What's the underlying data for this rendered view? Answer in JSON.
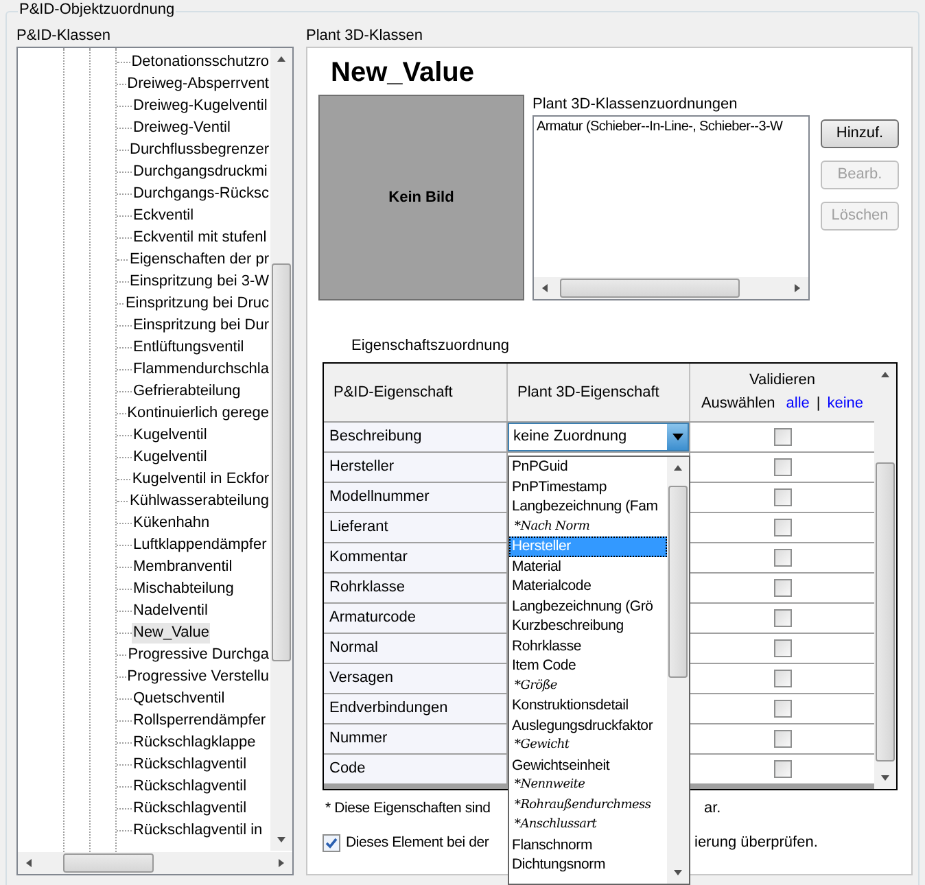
{
  "group_title": "P&ID-Objektzuordnung",
  "left": {
    "label": "P&ID-Klassen",
    "tree_items": [
      {
        "label": "Detonationsschutzro",
        "selected": false
      },
      {
        "label": "Dreiweg-Absperrvent",
        "selected": false
      },
      {
        "label": "Dreiweg-Kugelventil",
        "selected": false
      },
      {
        "label": "Dreiweg-Ventil",
        "selected": false
      },
      {
        "label": "Durchflussbegrenzer",
        "selected": false
      },
      {
        "label": "Durchgangsdruckmi",
        "selected": false
      },
      {
        "label": "Durchgangs-Rücksc",
        "selected": false
      },
      {
        "label": "Eckventil",
        "selected": false
      },
      {
        "label": "Eckventil mit stufenl",
        "selected": false
      },
      {
        "label": "Eigenschaften der pr",
        "selected": false
      },
      {
        "label": "Einspritzung bei 3-W",
        "selected": false
      },
      {
        "label": "Einspritzung bei Druc",
        "selected": false
      },
      {
        "label": "Einspritzung bei Dur",
        "selected": false
      },
      {
        "label": "Entlüftungsventil",
        "selected": false
      },
      {
        "label": "Flammendurchschla",
        "selected": false
      },
      {
        "label": "Gefrierabteilung",
        "selected": false
      },
      {
        "label": "Kontinuierlich gerege",
        "selected": false
      },
      {
        "label": "Kugelventil",
        "selected": false
      },
      {
        "label": "Kugelventil",
        "selected": false
      },
      {
        "label": "Kugelventil in Eckfor",
        "selected": false
      },
      {
        "label": "Kühlwasserabteilung",
        "selected": false
      },
      {
        "label": "Kükenhahn",
        "selected": false
      },
      {
        "label": "Luftklappendämpfer",
        "selected": false
      },
      {
        "label": "Membranventil",
        "selected": false
      },
      {
        "label": "Mischabteilung",
        "selected": false
      },
      {
        "label": "Nadelventil",
        "selected": false
      },
      {
        "label": "New_Value",
        "selected": true
      },
      {
        "label": "Progressive Durchga",
        "selected": false
      },
      {
        "label": "Progressive Verstellu",
        "selected": false
      },
      {
        "label": "Quetschventil",
        "selected": false
      },
      {
        "label": "Rollsperrendämpfer",
        "selected": false
      },
      {
        "label": "Rückschlagklappe",
        "selected": false
      },
      {
        "label": "Rückschlagventil",
        "selected": false
      },
      {
        "label": "Rückschlagventil",
        "selected": false
      },
      {
        "label": "Rückschlagventil",
        "selected": false
      },
      {
        "label": "Rückschlagventil in",
        "selected": false
      }
    ]
  },
  "right": {
    "label": "Plant 3D-Klassen",
    "class_name": "New_Value",
    "image_placeholder": "Kein Bild",
    "assignments_label": "Plant 3D-Klassenzuordnungen",
    "assignments": [
      "Armatur (Schieber--In-Line-, Schieber--3-W"
    ],
    "buttons": [
      {
        "label": "Hinzuf.",
        "disabled": false
      },
      {
        "label": "Bearb.",
        "disabled": true
      },
      {
        "label": "Löschen",
        "disabled": true
      }
    ]
  },
  "properties": {
    "label": "Eigenschaftszuordnung",
    "columns": [
      "P&ID-Eigenschaft",
      "Plant 3D-Eigenschaft"
    ],
    "validate_header": "Validieren",
    "select_label": "Auswählen",
    "select_all": "alle",
    "separator": "|",
    "select_none": "keine",
    "rows": [
      {
        "name": "Beschreibung",
        "mapping": "keine Zuordnung",
        "validate": false
      },
      {
        "name": "Hersteller",
        "validate": false
      },
      {
        "name": "Modellnummer",
        "validate": false
      },
      {
        "name": "Lieferant",
        "validate": false
      },
      {
        "name": "Kommentar",
        "validate": false
      },
      {
        "name": "Rohrklasse",
        "validate": false
      },
      {
        "name": "Armaturcode",
        "validate": false
      },
      {
        "name": "Normal",
        "validate": false
      },
      {
        "name": "Versagen",
        "validate": false
      },
      {
        "name": "Endverbindungen",
        "validate": false
      },
      {
        "name": "Nummer",
        "validate": false
      },
      {
        "name": "Code",
        "validate": false
      }
    ],
    "footnote": [
      "* Diese Eigenschaften sind",
      "ar."
    ],
    "check_element": {
      "checked": true,
      "text": [
        "Dieses Element bei der",
        "ierung überprüfen."
      ]
    }
  },
  "dropdown": {
    "options": [
      {
        "label": "PnPGuid",
        "italic": false,
        "selected": false
      },
      {
        "label": "PnPTimestamp",
        "italic": false,
        "selected": false
      },
      {
        "label": "Langbezeichnung (Fam",
        "italic": false,
        "selected": false
      },
      {
        "label": "*Nach Norm",
        "italic": true,
        "selected": false
      },
      {
        "label": "Hersteller",
        "italic": false,
        "selected": true
      },
      {
        "label": "Material",
        "italic": false,
        "selected": false
      },
      {
        "label": "Materialcode",
        "italic": false,
        "selected": false
      },
      {
        "label": "Langbezeichnung (Grö",
        "italic": false,
        "selected": false
      },
      {
        "label": "Kurzbeschreibung",
        "italic": false,
        "selected": false
      },
      {
        "label": "Rohrklasse",
        "italic": false,
        "selected": false
      },
      {
        "label": "Item Code",
        "italic": false,
        "selected": false
      },
      {
        "label": "*Größe",
        "italic": true,
        "selected": false
      },
      {
        "label": "Konstruktionsdetail",
        "italic": false,
        "selected": false
      },
      {
        "label": "Auslegungsdruckfaktor",
        "italic": false,
        "selected": false
      },
      {
        "label": "*Gewicht",
        "italic": true,
        "selected": false
      },
      {
        "label": "Gewichtseinheit",
        "italic": false,
        "selected": false
      },
      {
        "label": "*Nennweite",
        "italic": true,
        "selected": false
      },
      {
        "label": "*Rohraußendurchmess",
        "italic": true,
        "selected": false
      },
      {
        "label": "*Anschlussart",
        "italic": true,
        "selected": false
      },
      {
        "label": "Flanschnorm",
        "italic": false,
        "selected": false
      },
      {
        "label": "Dichtungsnorm",
        "italic": false,
        "selected": false
      }
    ]
  }
}
